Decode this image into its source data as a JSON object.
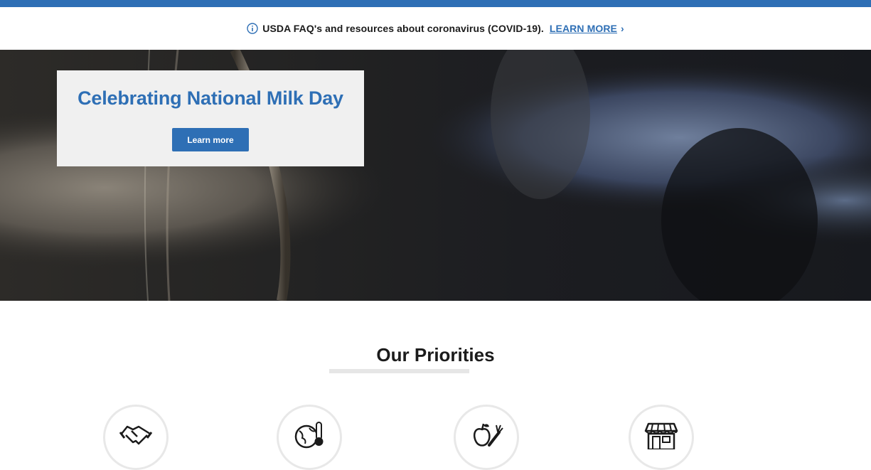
{
  "alert": {
    "icon": "info-icon",
    "text": "USDA FAQ's and resources about coronavirus (COVID-19).",
    "link_label": "LEARN MORE",
    "chevron": "›"
  },
  "hero": {
    "title": "Celebrating National Milk Day",
    "button_label": "Learn more"
  },
  "priorities": {
    "heading": "Our Priorities",
    "items": [
      {
        "icon": "handshake-icon"
      },
      {
        "icon": "globe-thermometer-icon"
      },
      {
        "icon": "apple-carrot-icon"
      },
      {
        "icon": "storefront-icon"
      }
    ]
  },
  "colors": {
    "brand_blue": "#2e6fb5",
    "card_background": "#f0f0f0",
    "text": "#1b1b1b"
  }
}
